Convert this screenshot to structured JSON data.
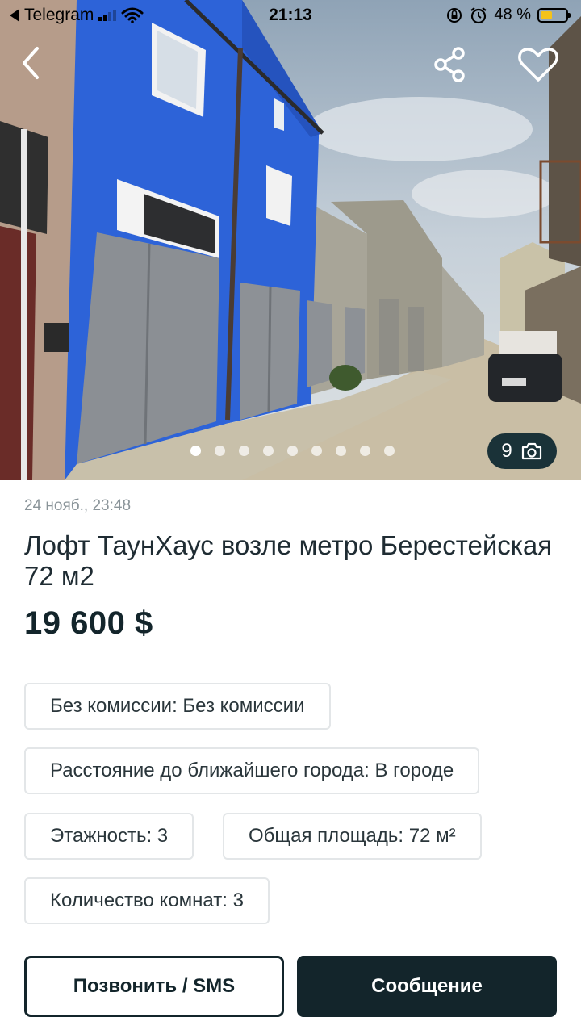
{
  "status_bar": {
    "back_app": "Telegram",
    "time": "21:13",
    "battery": "48 %",
    "battery_level": 0.48
  },
  "gallery": {
    "photo_count": "9",
    "dots_total": 9,
    "active_index": 0
  },
  "listing": {
    "date": "24 нояб., 23:48",
    "title": "Лофт ТаунХаус возле метро Берестейская 72 м2",
    "price": "19 600 $"
  },
  "params": [
    "Без комиссии: Без комиссии",
    "Расстояние до ближайшего города: В городе",
    "Этажность: 3",
    "Общая площадь: 72 м²",
    "Количество комнат: 3"
  ],
  "actions": {
    "call_label": "Позвонить / SMS",
    "message_label": "Сообщение"
  },
  "icons": {
    "back": "chevron-left-icon",
    "share": "share-icon",
    "favorite": "heart-icon",
    "camera": "camera-icon"
  },
  "colors": {
    "primary_dark": "#13252b",
    "chip_border": "#e3e6e8",
    "muted_text": "#8a9499"
  }
}
